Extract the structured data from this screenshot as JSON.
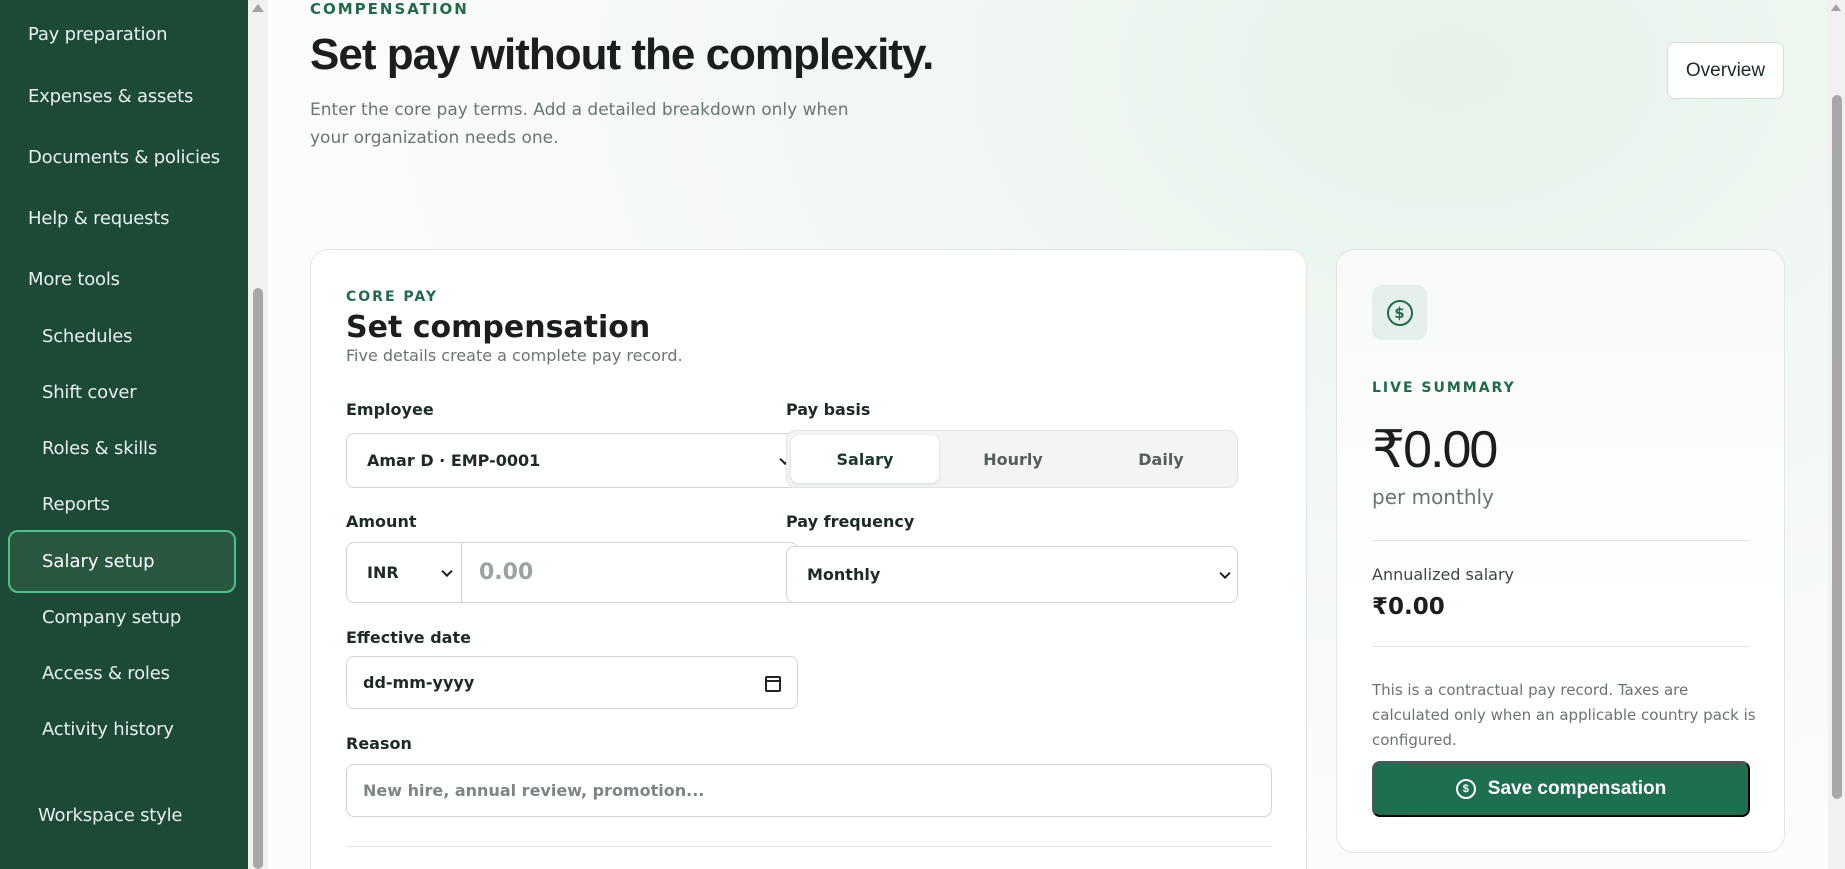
{
  "sidebar": {
    "items": [
      {
        "label": "Pay preparation"
      },
      {
        "label": "Expenses & assets"
      },
      {
        "label": "Documents & policies"
      },
      {
        "label": "Help & requests"
      },
      {
        "label": "More tools"
      }
    ],
    "sub_items": [
      {
        "label": "Schedules"
      },
      {
        "label": "Shift cover"
      },
      {
        "label": "Roles & skills"
      },
      {
        "label": "Reports"
      },
      {
        "label": "Salary setup",
        "active": true
      },
      {
        "label": "Company setup"
      },
      {
        "label": "Access & roles"
      },
      {
        "label": "Activity history"
      }
    ],
    "footer": "Workspace style"
  },
  "header": {
    "eyebrow": "COMPENSATION",
    "title": "Set pay without the complexity.",
    "subtitle": "Enter the core pay terms. Add a detailed breakdown only when your organization needs one.",
    "overview_label": "Overview"
  },
  "form": {
    "eyebrow": "CORE PAY",
    "title": "Set compensation",
    "subtitle": "Five details create a complete pay record.",
    "employee_label": "Employee",
    "employee_value": "Amar D · EMP-0001",
    "pay_basis_label": "Pay basis",
    "pay_basis_options": [
      "Salary",
      "Hourly",
      "Daily"
    ],
    "pay_basis_selected": "Salary",
    "amount_label": "Amount",
    "currency": "INR",
    "amount_placeholder": "0.00",
    "frequency_label": "Pay frequency",
    "frequency_value": "Monthly",
    "effective_date_label": "Effective date",
    "effective_date_placeholder": "dd-mm-yyyy",
    "reason_label": "Reason",
    "reason_placeholder": "New hire, annual review, promotion..."
  },
  "summary": {
    "icon": "dollar-coin-icon",
    "eyebrow": "LIVE SUMMARY",
    "amount": "₹0.00",
    "per": "per monthly",
    "annual_label": "Annualized salary",
    "annual_value": "₹0.00",
    "note": "This is a contractual pay record. Taxes are calculated only when an applicable country pack is configured.",
    "save_label": "Save compensation"
  },
  "colors": {
    "sidebar_bg": "#1c4a37",
    "accent": "#1f6b4a",
    "active_border": "#4fc08d",
    "primary_button": "#1c7050"
  }
}
